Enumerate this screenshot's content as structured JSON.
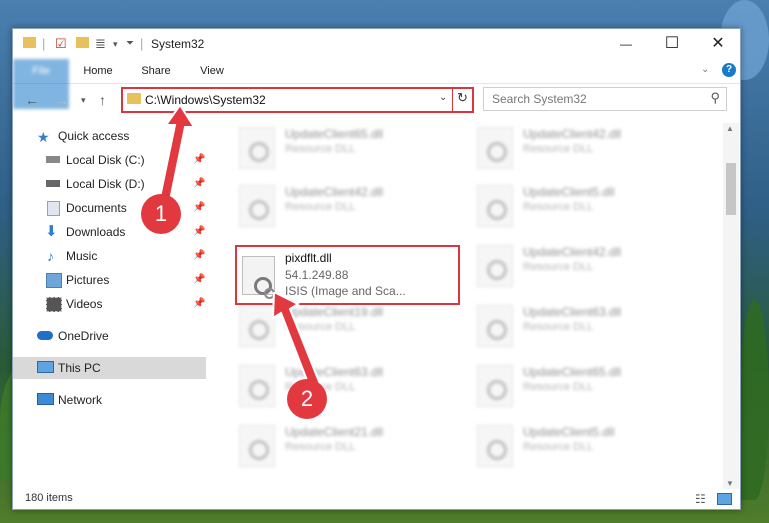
{
  "window": {
    "title": "System32",
    "controls": {
      "minimize": "—",
      "maximize": "☐",
      "close": "✕"
    }
  },
  "ribbon": {
    "tabs": [
      {
        "label": "File"
      },
      {
        "label": "Home"
      },
      {
        "label": "Share"
      },
      {
        "label": "View"
      }
    ],
    "help": "?"
  },
  "address": {
    "path": "C:\\Windows\\System32",
    "search_placeholder": "Search System32"
  },
  "sidebar": {
    "items": [
      {
        "label": "Quick access",
        "icon": "star-icon"
      },
      {
        "label": "Local Disk (C:)",
        "icon": "drive-icon"
      },
      {
        "label": "Local Disk (D:)",
        "icon": "drive-icon"
      },
      {
        "label": "Documents",
        "icon": "documents-icon"
      },
      {
        "label": "Downloads",
        "icon": "downloads-icon"
      },
      {
        "label": "Music",
        "icon": "music-icon"
      },
      {
        "label": "Pictures",
        "icon": "pictures-icon"
      },
      {
        "label": "Videos",
        "icon": "videos-icon"
      },
      {
        "label": "OneDrive",
        "icon": "cloud-icon"
      },
      {
        "label": "This PC",
        "icon": "computer-icon"
      },
      {
        "label": "Network",
        "icon": "network-icon"
      }
    ]
  },
  "files": {
    "left": [
      {
        "name": "UpdateClient65.dll",
        "type": "Resource DLL"
      },
      {
        "name": "UpdateClient42.dll",
        "type": "Resource DLL"
      },
      {
        "name": "UpdateClient19.dll",
        "type": "Resource DLL"
      },
      {
        "name": "UpdateClient63.dll",
        "type": "Resource DLL"
      },
      {
        "name": "UpdateClient21.dll",
        "type": "Resource DLL"
      }
    ],
    "right": [
      {
        "name": "UpdateClient42.dll",
        "type": "Resource DLL"
      },
      {
        "name": "UpdateClient5.dll",
        "type": "Resource DLL"
      },
      {
        "name": "UpdateClient42.dll",
        "type": "Resource DLL"
      },
      {
        "name": "UpdateClient63.dll",
        "type": "Resource DLL"
      },
      {
        "name": "UpdateClient65.dll",
        "type": "Resource DLL"
      },
      {
        "name": "UpdateClient5.dll",
        "type": "Resource DLL"
      }
    ],
    "highlighted": {
      "name": "pixdflt.dll",
      "version": "54.1.249.88",
      "description": "ISIS (Image and Sca..."
    }
  },
  "status": {
    "item_count": "180 items"
  },
  "annotations": {
    "badge1": "1",
    "badge2": "2",
    "color": "#e1393f"
  }
}
